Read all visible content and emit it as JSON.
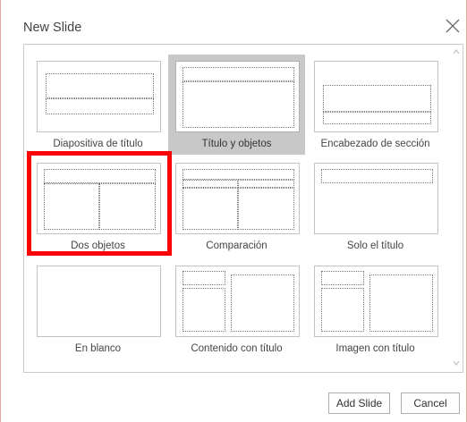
{
  "dialog": {
    "title": "New Slide",
    "close_icon": "close-icon"
  },
  "layouts": [
    {
      "label": "Diapositiva de título",
      "selected": false
    },
    {
      "label": "Título y objetos",
      "selected": true
    },
    {
      "label": "Encabezado de sección",
      "selected": false
    },
    {
      "label": "Dos objetos",
      "selected": false
    },
    {
      "label": "Comparación",
      "selected": false
    },
    {
      "label": "Solo el título",
      "selected": false
    },
    {
      "label": "En blanco",
      "selected": false
    },
    {
      "label": "Contenido con título",
      "selected": false
    },
    {
      "label": "Imagen con título",
      "selected": false
    }
  ],
  "highlighted_layout": "Dos objetos",
  "buttons": {
    "add_slide": "Add Slide",
    "cancel": "Cancel"
  },
  "colors": {
    "selected_bg": "#c8c8c8",
    "highlight": "#ff0000",
    "border_accent": "#e4a99a"
  }
}
